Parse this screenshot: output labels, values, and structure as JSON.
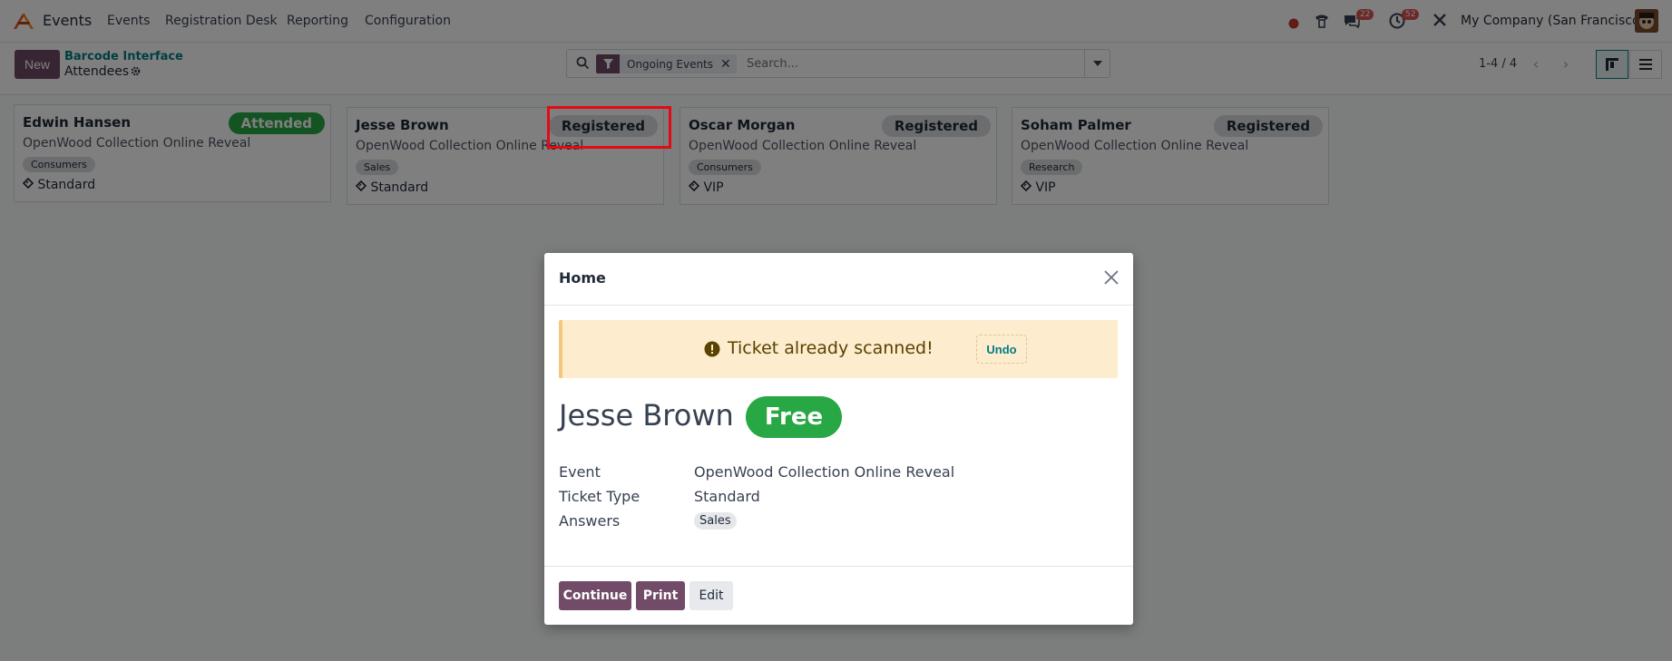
{
  "navbar": {
    "app_name": "Events",
    "menu": [
      "Events",
      "Registration Desk",
      "Reporting",
      "Configuration"
    ],
    "messages_count": "22",
    "activities_count": "52",
    "company": "My Company (San Francisco)"
  },
  "control": {
    "new_label": "New",
    "breadcrumb_parent": "Barcode Interface",
    "breadcrumb_current": "Attendees",
    "facet_label": "Ongoing Events",
    "search_placeholder": "Search...",
    "pager": "1-4 / 4"
  },
  "cards": [
    {
      "name": "Edwin Hansen",
      "event": "OpenWood Collection Online Reveal",
      "tag": "Consumers",
      "ticket": "Standard",
      "status": "Attended"
    },
    {
      "name": "Jesse Brown",
      "event": "OpenWood Collection Online Reveal",
      "tag": "Sales",
      "ticket": "Standard",
      "status": "Registered"
    },
    {
      "name": "Oscar Morgan",
      "event": "OpenWood Collection Online Reveal",
      "tag": "Consumers",
      "ticket": "VIP",
      "status": "Registered"
    },
    {
      "name": "Soham Palmer",
      "event": "OpenWood Collection Online Reveal",
      "tag": "Research",
      "ticket": "VIP",
      "status": "Registered"
    }
  ],
  "modal": {
    "title": "Home",
    "alert_text": "Ticket already scanned!",
    "undo_label": "Undo",
    "attendee_name": "Jesse Brown",
    "price_badge": "Free",
    "fields": [
      {
        "label": "Event",
        "value": "OpenWood Collection Online Reveal"
      },
      {
        "label": "Ticket Type",
        "value": "Standard"
      },
      {
        "label": "Answers",
        "value": "Sales"
      }
    ],
    "buttons": {
      "continue": "Continue",
      "print": "Print",
      "edit": "Edit"
    }
  },
  "colors": {
    "brand": "#714b67",
    "link": "#017e84",
    "attended": "#28a745",
    "highlight": "#e50914",
    "alert_bg": "#fdecce"
  }
}
